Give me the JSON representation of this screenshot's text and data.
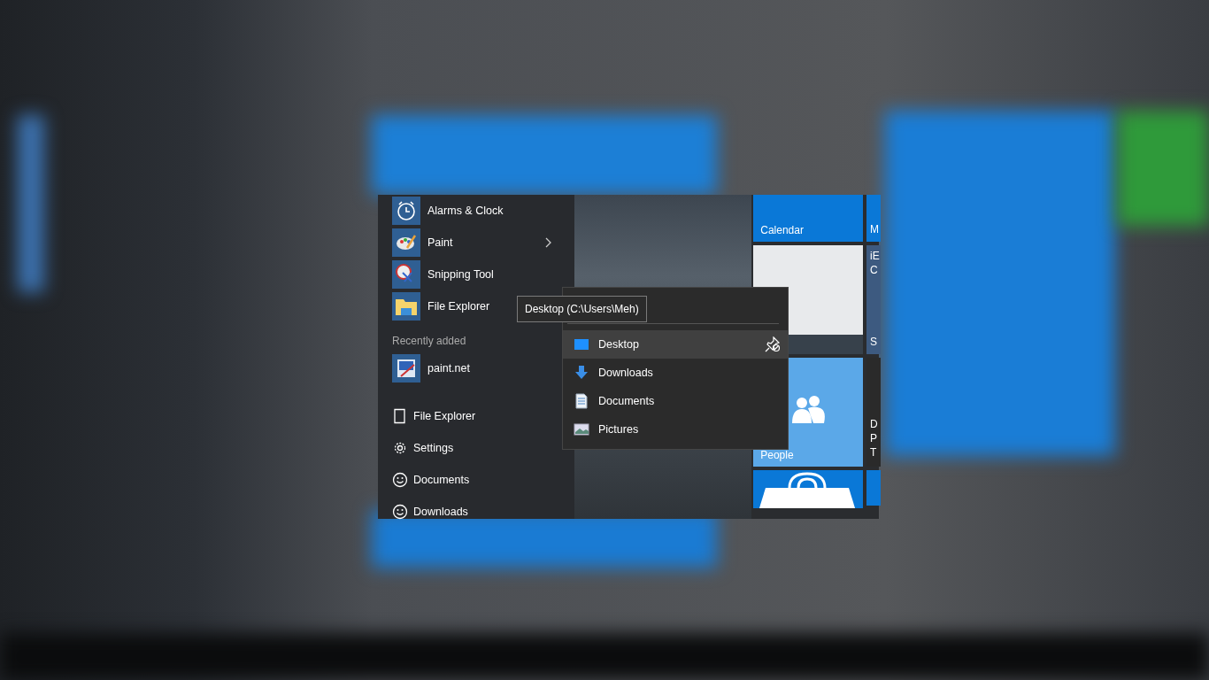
{
  "start_menu": {
    "apps": [
      {
        "name": "Alarms & Clock",
        "kind": "alarm",
        "has_submenu": false
      },
      {
        "name": "Paint",
        "kind": "paint",
        "has_submenu": true
      },
      {
        "name": "Snipping Tool",
        "kind": "snip",
        "has_submenu": false
      },
      {
        "name": "File Explorer",
        "kind": "folder"
      }
    ],
    "recently_added": {
      "heading": "Recently added",
      "apps": [
        {
          "name": "paint.net",
          "kind": "paintnet"
        }
      ]
    },
    "places": [
      {
        "name": "File Explorer",
        "kind": "file"
      },
      {
        "name": "Settings",
        "kind": "gear"
      },
      {
        "name": "Documents",
        "kind": "smiley"
      },
      {
        "name": "Downloads",
        "kind": "smiley"
      }
    ]
  },
  "tiles": [
    {
      "kind": "calendar",
      "label": "Calendar"
    },
    {
      "kind": "screenshot"
    },
    {
      "kind": "people",
      "label": "People"
    },
    {
      "kind": "store"
    }
  ],
  "partial_tiles": [
    {
      "kind": "blue",
      "lines": [
        "M"
      ]
    },
    {
      "kind": "slate",
      "lines": [
        "iE",
        "C"
      ],
      "label": "S"
    },
    {
      "kind": "dark",
      "lines": [
        "D",
        "P",
        "T"
      ]
    },
    {
      "kind": "blue"
    }
  ],
  "tooltip": "Desktop (C:\\Users\\Meh)",
  "jump_list": {
    "items": [
      {
        "name": "Desktop",
        "kind": "desktop",
        "selected": true
      },
      {
        "name": "Downloads",
        "kind": "download",
        "selected": false
      },
      {
        "name": "Documents",
        "kind": "document",
        "selected": false
      },
      {
        "name": "Pictures",
        "kind": "picture",
        "selected": false
      }
    ]
  }
}
